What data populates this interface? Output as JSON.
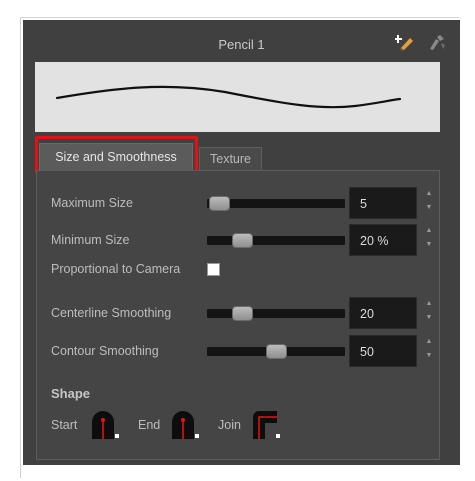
{
  "panel": {
    "title": "Pencil 1"
  },
  "icons": {
    "add_preset": "pencil-plus-icon",
    "brush_options": "brush-icon"
  },
  "tabs": [
    {
      "label": "Size and Smoothness",
      "active": true
    },
    {
      "label": "Texture",
      "active": false
    }
  ],
  "settings": {
    "max_size": {
      "label": "Maximum Size",
      "value": "5",
      "slider_fraction": 0.04
    },
    "min_size": {
      "label": "Minimum Size",
      "value": "20 %",
      "slider_fraction": 0.2
    },
    "proportional": {
      "label": "Proportional to Camera",
      "checked": false
    },
    "centerline": {
      "label": "Centerline Smoothing",
      "value": "20",
      "slider_fraction": 0.2
    },
    "contour": {
      "label": "Contour Smoothing",
      "value": "50",
      "slider_fraction": 0.5
    }
  },
  "shape": {
    "title": "Shape",
    "start_label": "Start",
    "end_label": "End",
    "join_label": "Join"
  },
  "colors": {
    "panel_bg": "#404040",
    "highlight": "#e11212",
    "field_bg": "#1a1a1a"
  }
}
